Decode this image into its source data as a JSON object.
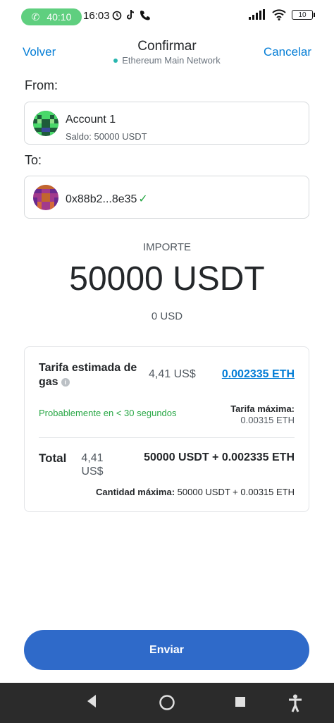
{
  "status_bar": {
    "call_timer": "40:10",
    "time": "16:03",
    "battery": "10"
  },
  "header": {
    "back_label": "Volver",
    "title": "Confirmar",
    "network": "Ethereum Main Network",
    "cancel_label": "Cancelar"
  },
  "from": {
    "label": "From:",
    "account_name": "Account 1",
    "balance": "Saldo: 50000 USDT"
  },
  "to": {
    "label": "To:",
    "address": "0x88b2...8e35"
  },
  "amount": {
    "label": "IMPORTE",
    "value": "50000 USDT",
    "fiat": "0 USD"
  },
  "fee": {
    "title": "Tarifa estimada de gas",
    "fiat": "4,41 US$",
    "eth": "0.002335 ETH",
    "time_estimate": "Probablemente en < 30 segundos",
    "max_fee_label": "Tarifa máxima:",
    "max_fee_value": "0.00315 ETH"
  },
  "total": {
    "label": "Total",
    "fiat": "4,41 US$",
    "value": "50000 USDT + 0.002335 ETH",
    "max_label": "Cantidad máxima:",
    "max_value": "50000 USDT + 0.00315 ETH"
  },
  "send_button": {
    "label": "Enviar",
    "color": "#2f6ac9"
  },
  "colors": {
    "link": "#037dd6",
    "success": "#28a745"
  },
  "icons": {
    "status_left": [
      "alarm-icon",
      "tiktok-icon",
      "phone-icon"
    ],
    "status_right": [
      "signal-icon",
      "wifi-icon",
      "battery-icon"
    ],
    "nav": [
      "back-triangle-icon",
      "home-circle-icon",
      "recents-square-icon",
      "accessibility-icon"
    ]
  }
}
